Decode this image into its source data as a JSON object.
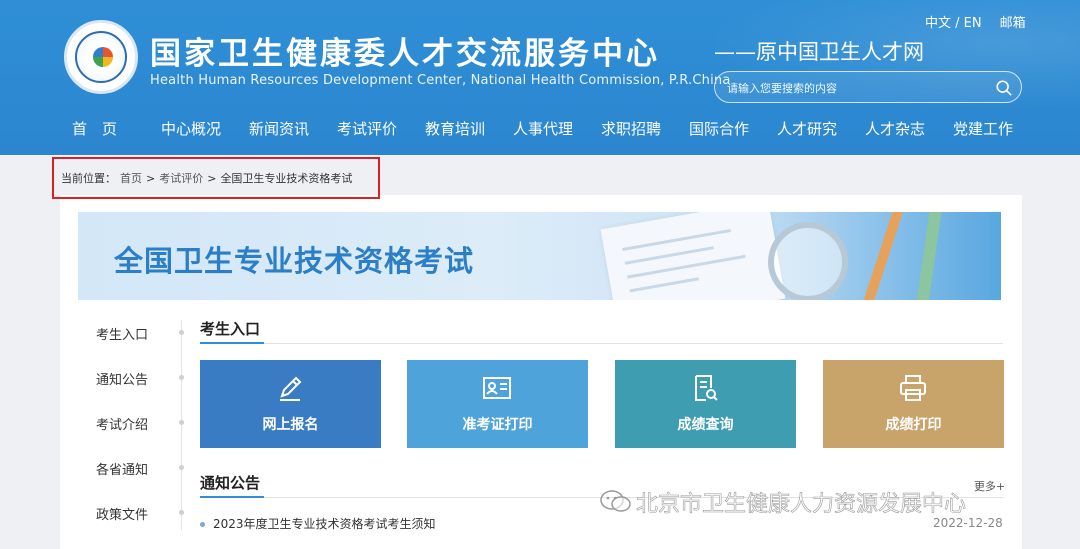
{
  "header": {
    "title_cn": "国家卫生健康委人才交流服务中心",
    "title_en": "Health Human Resources Development Center, National Health Commission, P.R.China",
    "formerly": "——原中国卫生人才网",
    "lang_switch": "中文 / EN",
    "mail": "邮箱",
    "search_placeholder": "请输入您要搜索的内容"
  },
  "nav": [
    "首　页",
    "中心概况",
    "新闻资讯",
    "考试评价",
    "教育培训",
    "人事代理",
    "求职招聘",
    "国际合作",
    "人才研究",
    "人才杂志",
    "党建工作"
  ],
  "breadcrumb": {
    "label": "当前位置：",
    "items": [
      "首页",
      ">",
      "考试评价",
      ">",
      "全国卫生专业技术资格考试"
    ]
  },
  "banner": {
    "title": "全国卫生专业技术资格考试"
  },
  "side_menu": [
    "考生入口",
    "通知公告",
    "考试介绍",
    "各省通知",
    "政策文件"
  ],
  "sections": {
    "entry_title": "考生入口",
    "notice_title": "通知公告",
    "more": "更多+"
  },
  "tiles": [
    {
      "label": "网上报名",
      "icon": "pencil-icon",
      "color": "#3a7cc4"
    },
    {
      "label": "准考证打印",
      "icon": "id-card-icon",
      "color": "#4fa3db"
    },
    {
      "label": "成绩查询",
      "icon": "document-search-icon",
      "color": "#3e9db0"
    },
    {
      "label": "成绩打印",
      "icon": "printer-icon",
      "color": "#c9a46a"
    }
  ],
  "notices": [
    {
      "title": "2023年度卫生专业技术资格考试考生须知",
      "date": "2022-12-28"
    }
  ],
  "watermark": "北京市卫生健康人力资源发展中心",
  "colors": {
    "header_blue": "#2f8fd6",
    "highlight_red": "#e02020"
  }
}
